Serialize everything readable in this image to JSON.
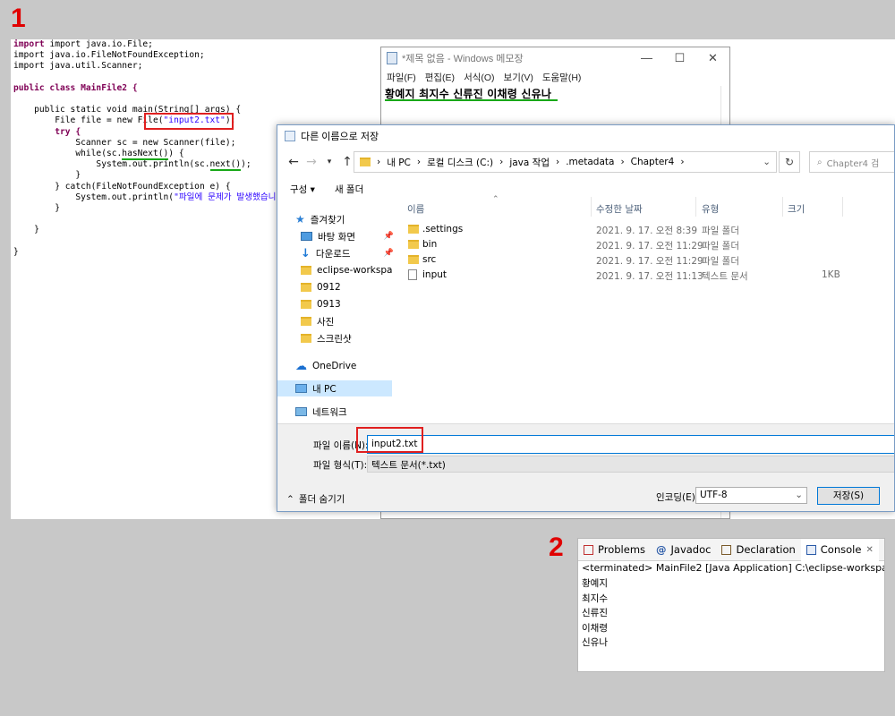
{
  "labels": {
    "step1": "1",
    "step2": "2"
  },
  "code": {
    "line_import1": "import java.io.File;",
    "line_import2": "import java.io.FileNotFoundException;",
    "line_import3": "import java.util.Scanner;",
    "class_decl": "public class MainFile2 {",
    "main_decl": "public static void main(String[] args) {",
    "file_decl_a": "File file = new File(",
    "file_name_str": "\"input2.txt\"",
    "file_decl_b": ");",
    "try_kw": "try {",
    "scanner_decl": "Scanner sc = new Scanner(file);",
    "while_a": "while(sc.",
    "while_has_next": "hasNext()",
    "while_b": ") {",
    "println_a": "System.out.println(sc.",
    "println_next": "next()",
    "println_b": ");",
    "close_inner": "}",
    "catch_line": "} catch(FileNotFoundException e) {",
    "err_print_a": "System.out.println(",
    "err_print_str": "\"파일에 문제가 발생했습니다.",
    "close_try": "}",
    "close_main": "}",
    "close_class": "}"
  },
  "notepad": {
    "title": "*제목 없음 - Windows 메모장",
    "menu": [
      "파일(F)",
      "편집(E)",
      "서식(O)",
      "보기(V)",
      "도움말(H)"
    ],
    "content": "황예지 최지수 신류진 이채령 신유나"
  },
  "save_dialog": {
    "title": "다른 이름으로 저장",
    "address": [
      "내 PC",
      "로컬 디스크 (C:)",
      "java 작업",
      ".metadata",
      "Chapter4"
    ],
    "search_placeholder": "Chapter4 검",
    "toolbar": {
      "organize": "구성 ▾",
      "new_folder": "새 폴더"
    },
    "nav": {
      "favorites": "즐겨찾기",
      "desktop": "바탕 화면",
      "downloads": "다운로드",
      "eclipse": "eclipse-workspa",
      "f0912": "0912",
      "f0913": "0913",
      "photos": "사진",
      "screenshot": "스크린샷",
      "onedrive": "OneDrive",
      "mypc": "내 PC",
      "network": "네트워크"
    },
    "columns": {
      "name": "이름",
      "date": "수정한 날짜",
      "type": "유형",
      "size": "크기"
    },
    "files": [
      {
        "name": ".settings",
        "date": "2021. 9. 17. 오전 8:39",
        "type": "파일 폴더",
        "size": ""
      },
      {
        "name": "bin",
        "date": "2021. 9. 17. 오전 11:29",
        "type": "파일 폴더",
        "size": ""
      },
      {
        "name": "src",
        "date": "2021. 9. 17. 오전 11:29",
        "type": "파일 폴더",
        "size": ""
      },
      {
        "name": "input",
        "date": "2021. 9. 17. 오전 11:13",
        "type": "텍스트 문서",
        "size": "1KB"
      }
    ],
    "filename_label": "파일 이름(N):",
    "filename_value": "input2.txt",
    "filetype_label": "파일 형식(T):",
    "filetype_value": "텍스트 문서(*.txt)",
    "hide_folders": "폴더 숨기기",
    "encoding_label": "인코딩(E):",
    "encoding_value": "UTF-8",
    "save_button": "저장(S)"
  },
  "console": {
    "tabs": [
      "Problems",
      "Javadoc",
      "Declaration",
      "Console"
    ],
    "terminated": "<terminated> MainFile2 [Java Application] C:\\eclipse-workspa",
    "output": [
      "황예지",
      "최지수",
      "신류진",
      "이채령",
      "신유나"
    ]
  }
}
